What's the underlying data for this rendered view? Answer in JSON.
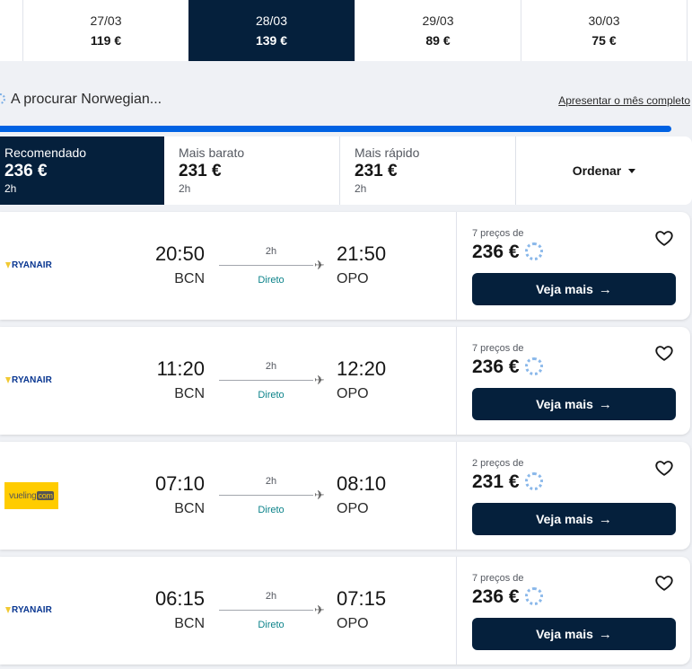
{
  "date_strip": [
    {
      "date": "27/03",
      "price": "119 €"
    },
    {
      "date": "28/03",
      "price": "139 €",
      "active": true
    },
    {
      "date": "29/03",
      "price": "89 €"
    },
    {
      "date": "30/03",
      "price": "75 €"
    }
  ],
  "search": {
    "status": "A procurar Norwegian...",
    "month_link": "Apresentar o mês completo",
    "progress_percent": 97
  },
  "sort": {
    "tabs": [
      {
        "label": "Recomendado",
        "price": "236 €",
        "duration": "2h"
      },
      {
        "label": "Mais barato",
        "price": "231 €",
        "duration": "2h"
      },
      {
        "label": "Mais rápido",
        "price": "231 €",
        "duration": "2h"
      }
    ],
    "order_label": "Ordenar"
  },
  "results": [
    {
      "airline": "ryanair",
      "airline_name": "RYANAIR",
      "dep_time": "20:50",
      "dep_airport": "BCN",
      "duration": "2h",
      "stops": "Direto",
      "arr_time": "21:50",
      "arr_airport": "OPO",
      "price_count": "7 preços de",
      "price": "236 €",
      "cta": "Veja mais"
    },
    {
      "airline": "ryanair",
      "airline_name": "RYANAIR",
      "dep_time": "11:20",
      "dep_airport": "BCN",
      "duration": "2h",
      "stops": "Direto",
      "arr_time": "12:20",
      "arr_airport": "OPO",
      "price_count": "7 preços de",
      "price": "236 €",
      "cta": "Veja mais"
    },
    {
      "airline": "vueling",
      "airline_name": "vueling",
      "airline_name_suffix": "com",
      "dep_time": "07:10",
      "dep_airport": "BCN",
      "duration": "2h",
      "stops": "Direto",
      "arr_time": "08:10",
      "arr_airport": "OPO",
      "price_count": "2 preços de",
      "price": "231 €",
      "cta": "Veja mais"
    },
    {
      "airline": "ryanair",
      "airline_name": "RYANAIR",
      "dep_time": "06:15",
      "dep_airport": "BCN",
      "duration": "2h",
      "stops": "Direto",
      "arr_time": "07:15",
      "arr_airport": "OPO",
      "price_count": "7 preços de",
      "price": "236 €",
      "cta": "Veja mais"
    }
  ],
  "colors": {
    "primary": "#05203c",
    "accent": "#0062e3",
    "direct": "#0c838a"
  },
  "icons": {
    "heart": "heart-outline-icon",
    "arrow": "arrow-right-icon",
    "plane": "plane-icon",
    "caret": "caret-down-icon",
    "loading": "loading-spinner-icon"
  }
}
